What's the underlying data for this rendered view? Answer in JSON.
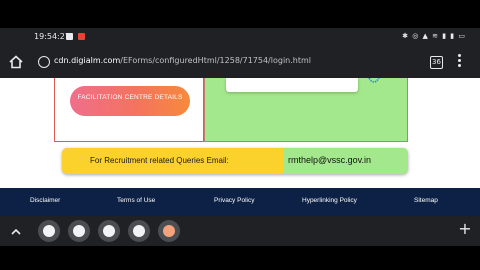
{
  "status_bar": {
    "time": "19:54:27",
    "icons_text": "✱ ◎ ▲ ≋ ▮ ▮ ▭"
  },
  "browser": {
    "url_host": "cdn.digialm.com",
    "url_path": "/EForms/configuredHtml/1258/71754/login.html",
    "tab_count": "36"
  },
  "page": {
    "facilitation_button": "FACILITATION CENTRE DETAILS",
    "query_label": "For Recruitment related Queries Email:",
    "query_email": "rmthelp@vssc.gov.in"
  },
  "footer": {
    "links": [
      "Disclaimer",
      "Terms of Use",
      "Privacy Policy",
      "Hyperlinking Policy",
      "Sitemap"
    ]
  },
  "colors": {
    "footer_bg": "#0d2146",
    "strip_yellow": "#fbd12b",
    "green_panel": "#a3e88c",
    "button_gradient_start": "#ef6e8b",
    "button_gradient_end": "#f78a3c"
  }
}
